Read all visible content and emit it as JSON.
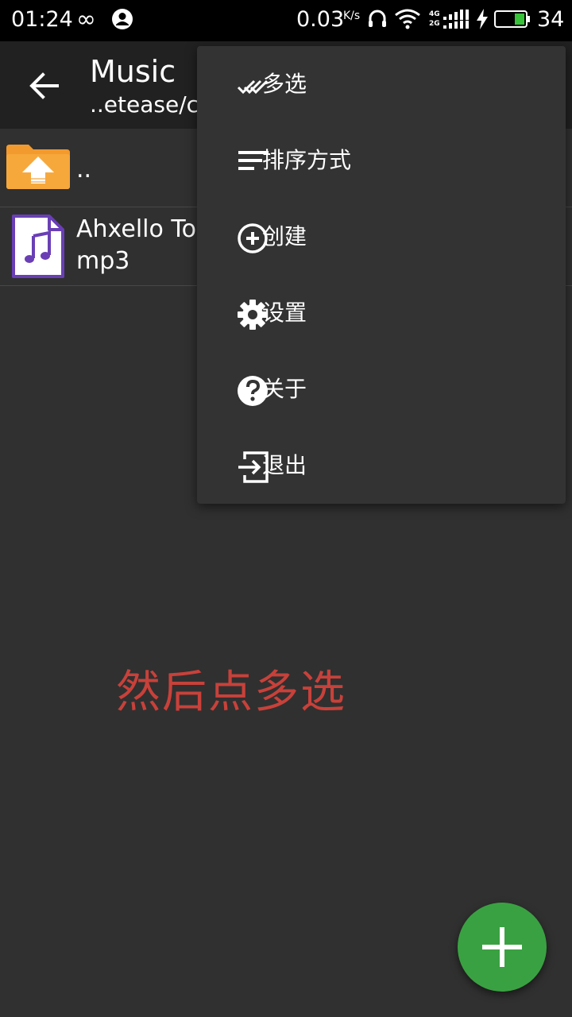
{
  "status_bar": {
    "time": "01:24",
    "loop_symbol": "∞",
    "network_speed": "0.03",
    "speed_unit": "K/s",
    "net_label_top": "4G",
    "net_label_bottom": "2G",
    "battery_level": "34"
  },
  "toolbar": {
    "title": "Music",
    "path": "..etease/c"
  },
  "file_list": [
    {
      "name": "..",
      "icon": "folder-up-icon"
    },
    {
      "name_line1": "Ahxello To",
      "name_line2": "mp3",
      "icon": "audio-file-icon"
    }
  ],
  "overflow_menu": [
    {
      "label": "多选",
      "icon": "multi-select-icon"
    },
    {
      "label": "排序方式",
      "icon": "sort-icon"
    },
    {
      "label": "创建",
      "icon": "add-circle-icon"
    },
    {
      "label": "设置",
      "icon": "gear-icon"
    },
    {
      "label": "关于",
      "icon": "help-icon"
    },
    {
      "label": "退出",
      "icon": "exit-icon"
    }
  ],
  "annotation": "然后点多选",
  "colors": {
    "background": "#303030",
    "toolbar": "#212121",
    "menu": "#333333",
    "fab": "#3aa142",
    "annotation": "#c8413a",
    "folder": "#f29a2e",
    "audio_accent": "#6a3fb5"
  },
  "fab": {
    "icon": "plus-icon"
  }
}
